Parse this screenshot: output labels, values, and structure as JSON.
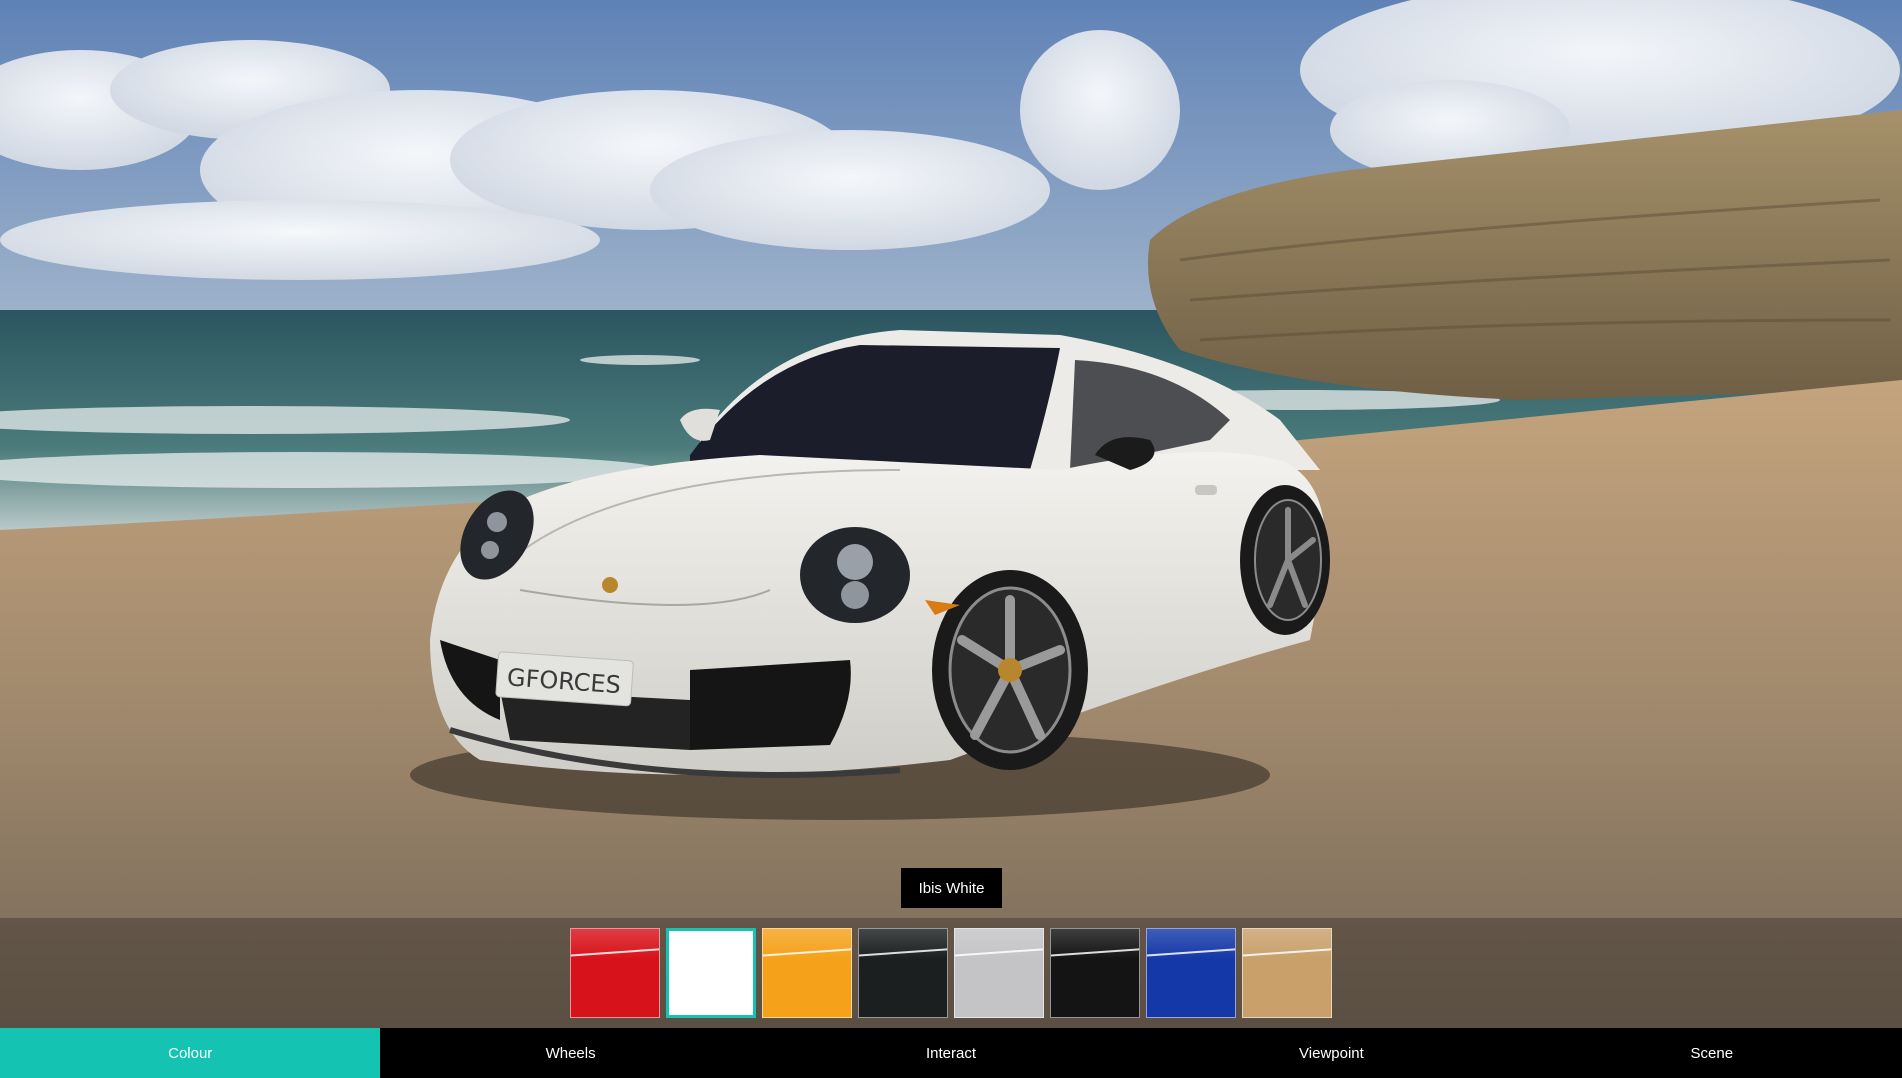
{
  "viewer": {
    "selected_colour_name": "Ibis White",
    "plate_text": "GFORCES"
  },
  "swatches": [
    {
      "name": "red",
      "color": "#d8121a",
      "selected": false
    },
    {
      "name": "white",
      "color": "#ffffff",
      "selected": true
    },
    {
      "name": "orange",
      "color": "#f6a11a",
      "selected": false
    },
    {
      "name": "dark-grey",
      "color": "#1b1f20",
      "selected": false
    },
    {
      "name": "silver",
      "color": "#c4c4c6",
      "selected": false
    },
    {
      "name": "black",
      "color": "#141414",
      "selected": false
    },
    {
      "name": "blue",
      "color": "#1538a8",
      "selected": false
    },
    {
      "name": "gold",
      "color": "#c9a06a",
      "selected": false
    }
  ],
  "tabs": [
    {
      "label": "Colour",
      "active": true
    },
    {
      "label": "Wheels",
      "active": false
    },
    {
      "label": "Interact",
      "active": false
    },
    {
      "label": "Viewpoint",
      "active": false
    },
    {
      "label": "Scene",
      "active": false
    }
  ],
  "colors": {
    "accent": "#14c3b1"
  }
}
